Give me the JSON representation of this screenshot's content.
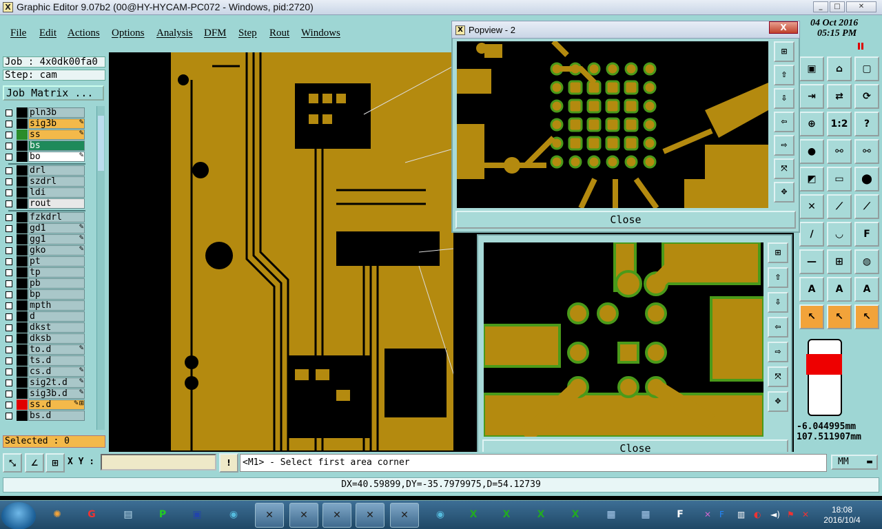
{
  "window": {
    "title": "Graphic Editor 9.07b2 (00@HY-HYCAM-PC072 - Windows, pid:2720)"
  },
  "menu": [
    "File",
    "Edit",
    "Actions",
    "Options",
    "Analysis",
    "DFM",
    "Step",
    "Rout",
    "Windows"
  ],
  "datetime": {
    "date": "04 Oct 2016",
    "time": "05:15 PM"
  },
  "job": {
    "job_label": "Job : 4x0dk00fa0",
    "step_label": "Step: cam",
    "matrix_button": "Job Matrix ..."
  },
  "layers": [
    {
      "name": "pln3b",
      "color": "#000000",
      "bg": "#a9c7c9"
    },
    {
      "name": "sig3b",
      "color": "#000000",
      "bg": "#f3b94a",
      "flag": "✎"
    },
    {
      "name": "ss",
      "color": "#2a8c2a",
      "bg": "#f3b94a",
      "flag": "✎"
    },
    {
      "name": "bs",
      "color": "#000000",
      "bg": "#1e8a5a"
    },
    {
      "name": "bo",
      "color": "#000000",
      "bg": "#ffffff",
      "flag": "✎"
    },
    {
      "name": "drl",
      "color": "#000000",
      "bg": "#a9c7c9"
    },
    {
      "name": "szdrl",
      "color": "#000000",
      "bg": "#a9c7c9"
    },
    {
      "name": "ldi",
      "color": "#000000",
      "bg": "#a9c7c9"
    },
    {
      "name": "rout",
      "color": "#000000",
      "bg": "#e8e8e8"
    },
    {
      "name": "fzkdrl",
      "color": "#000000",
      "bg": "#a9c7c9"
    },
    {
      "name": "gd1",
      "color": "#000000",
      "bg": "#a9c7c9",
      "flag": "✎"
    },
    {
      "name": "gg1",
      "color": "#000000",
      "bg": "#a9c7c9",
      "flag": "✎"
    },
    {
      "name": "gko",
      "color": "#000000",
      "bg": "#a9c7c9",
      "flag": "✎"
    },
    {
      "name": "pt",
      "color": "#000000",
      "bg": "#a9c7c9"
    },
    {
      "name": "tp",
      "color": "#000000",
      "bg": "#a9c7c9"
    },
    {
      "name": "pb",
      "color": "#000000",
      "bg": "#a9c7c9"
    },
    {
      "name": "bp",
      "color": "#000000",
      "bg": "#a9c7c9"
    },
    {
      "name": "mpth",
      "color": "#000000",
      "bg": "#a9c7c9"
    },
    {
      "name": "d",
      "color": "#000000",
      "bg": "#a9c7c9"
    },
    {
      "name": "dkst",
      "color": "#000000",
      "bg": "#a9c7c9"
    },
    {
      "name": "dksb",
      "color": "#000000",
      "bg": "#a9c7c9"
    },
    {
      "name": "to.d",
      "color": "#000000",
      "bg": "#a9c7c9",
      "flag": "✎"
    },
    {
      "name": "ts.d",
      "color": "#000000",
      "bg": "#a9c7c9"
    },
    {
      "name": "cs.d",
      "color": "#000000",
      "bg": "#a9c7c9",
      "flag": "✎"
    },
    {
      "name": "sig2t.d",
      "color": "#000000",
      "bg": "#a9c7c9",
      "flag": "✎"
    },
    {
      "name": "sig3b.d",
      "color": "#000000",
      "bg": "#a9c7c9",
      "flag": "✎"
    },
    {
      "name": "ss.d",
      "color": "#e00000",
      "bg": "#f3b94a",
      "flag": "✎⊞"
    },
    {
      "name": "bs.d",
      "color": "#000000",
      "bg": "#a9c7c9"
    }
  ],
  "selected": "Selected : 0",
  "popup1": {
    "title": "Popview - 2",
    "close": "Close",
    "close_x": "X"
  },
  "popup2": {
    "close": "Close"
  },
  "coords": {
    "x": "-6.044995mm",
    "y": "107.511907mm"
  },
  "command": {
    "xy_label": "X Y :",
    "input_value": "",
    "prompt": "<M1> - Select first area corner",
    "unit": "MM"
  },
  "status": "DX=40.59899,DY=-35.7979975,D=54.12739",
  "clock": {
    "time": "18:08",
    "date": "2016/10/4"
  },
  "colors": {
    "panel": "#9ed6d4",
    "copper": "#b48a0f",
    "pad_green": "#4a9a1a",
    "board": "#000000"
  }
}
